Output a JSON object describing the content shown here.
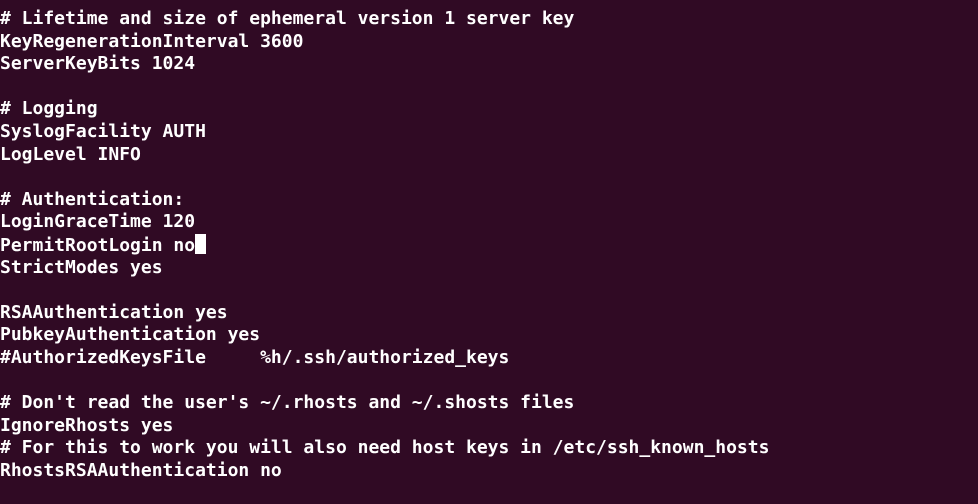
{
  "terminal": {
    "background": "#300a24",
    "foreground": "#ffffff",
    "lines": [
      "# Lifetime and size of ephemeral version 1 server key",
      "KeyRegenerationInterval 3600",
      "ServerKeyBits 1024",
      "",
      "# Logging",
      "SyslogFacility AUTH",
      "LogLevel INFO",
      "",
      "# Authentication:",
      "LoginGraceTime 120",
      "PermitRootLogin no",
      "StrictModes yes",
      "",
      "RSAAuthentication yes",
      "PubkeyAuthentication yes",
      "#AuthorizedKeysFile     %h/.ssh/authorized_keys",
      "",
      "# Don't read the user's ~/.rhosts and ~/.shosts files",
      "IgnoreRhosts yes",
      "# For this to work you will also need host keys in /etc/ssh_known_hosts",
      "RhostsRSAAuthentication no"
    ]
  }
}
